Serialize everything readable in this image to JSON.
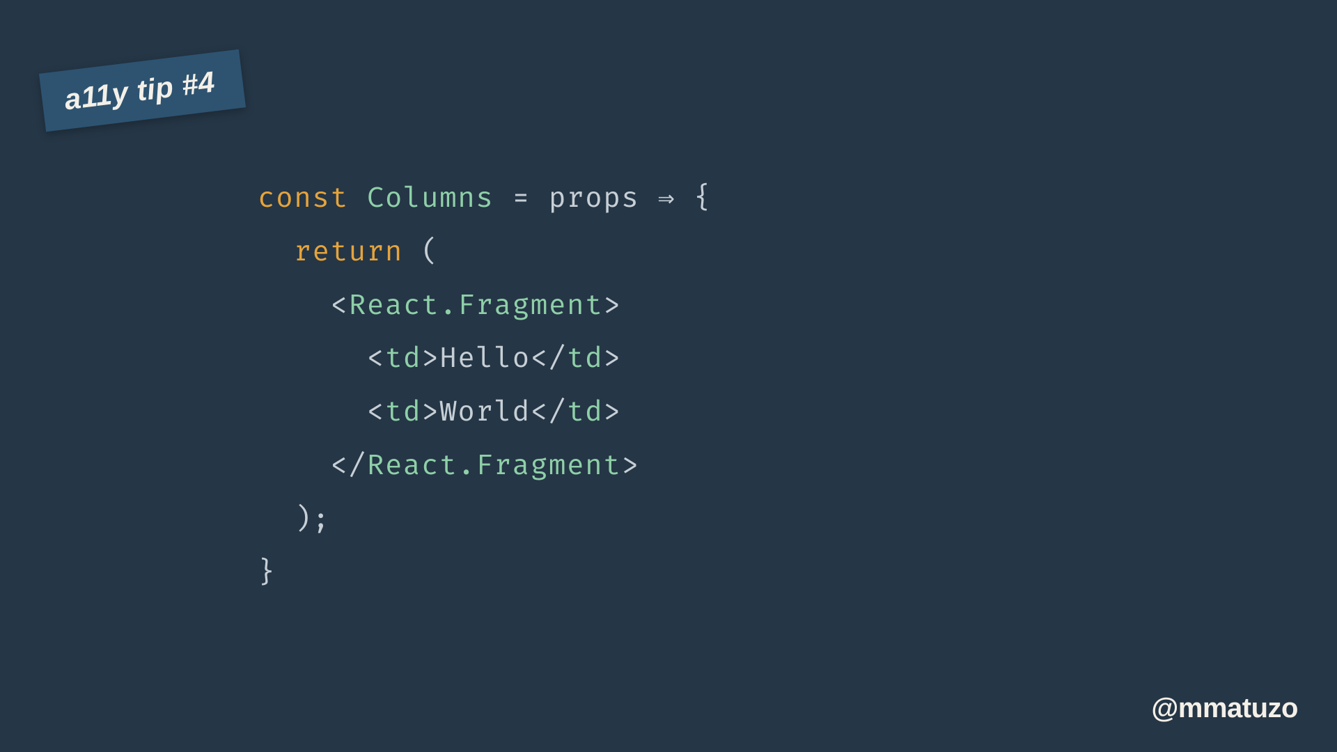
{
  "badge": {
    "text": "a11y tip #4"
  },
  "handle": {
    "text": "@mmatuzo"
  },
  "code": {
    "tokens": [
      [
        {
          "cls": "tok-keyword",
          "t": "const"
        },
        {
          "cls": "tok-op",
          "t": " "
        },
        {
          "cls": "tok-ident",
          "t": "Columns"
        },
        {
          "cls": "tok-op",
          "t": " = "
        },
        {
          "cls": "tok-text",
          "t": "props"
        },
        {
          "cls": "tok-op",
          "t": " "
        },
        {
          "cls": "tok-op",
          "t": "⇒"
        },
        {
          "cls": "tok-op",
          "t": " {"
        }
      ],
      [
        {
          "cls": "tok-op",
          "t": "  "
        },
        {
          "cls": "tok-keyword",
          "t": "return"
        },
        {
          "cls": "tok-op",
          "t": " ("
        }
      ],
      [
        {
          "cls": "tok-op",
          "t": "    "
        },
        {
          "cls": "tok-punct",
          "t": "<"
        },
        {
          "cls": "tok-tag",
          "t": "React.Fragment"
        },
        {
          "cls": "tok-punct",
          "t": ">"
        }
      ],
      [
        {
          "cls": "tok-op",
          "t": "      "
        },
        {
          "cls": "tok-punct",
          "t": "<"
        },
        {
          "cls": "tok-tag",
          "t": "td"
        },
        {
          "cls": "tok-punct",
          "t": ">"
        },
        {
          "cls": "tok-text",
          "t": "Hello"
        },
        {
          "cls": "tok-punct",
          "t": "</"
        },
        {
          "cls": "tok-tag",
          "t": "td"
        },
        {
          "cls": "tok-punct",
          "t": ">"
        }
      ],
      [
        {
          "cls": "tok-op",
          "t": "      "
        },
        {
          "cls": "tok-punct",
          "t": "<"
        },
        {
          "cls": "tok-tag",
          "t": "td"
        },
        {
          "cls": "tok-punct",
          "t": ">"
        },
        {
          "cls": "tok-text",
          "t": "World"
        },
        {
          "cls": "tok-punct",
          "t": "</"
        },
        {
          "cls": "tok-tag",
          "t": "td"
        },
        {
          "cls": "tok-punct",
          "t": ">"
        }
      ],
      [
        {
          "cls": "tok-op",
          "t": "    "
        },
        {
          "cls": "tok-punct",
          "t": "</"
        },
        {
          "cls": "tok-tag",
          "t": "React.Fragment"
        },
        {
          "cls": "tok-punct",
          "t": ">"
        }
      ],
      [
        {
          "cls": "tok-op",
          "t": "  );"
        }
      ],
      [
        {
          "cls": "tok-op",
          "t": "}"
        }
      ]
    ]
  }
}
